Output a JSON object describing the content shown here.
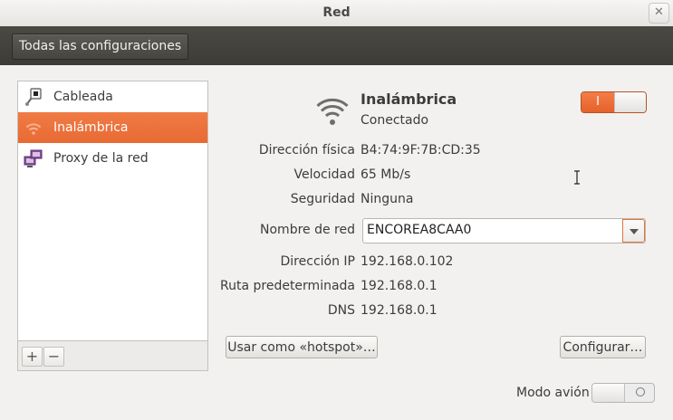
{
  "window": {
    "title": "Red"
  },
  "toolbar": {
    "all_settings_label": "Todas las configuraciones"
  },
  "sidebar": {
    "items": [
      {
        "label": "Cableada",
        "icon": "wired-network-icon",
        "selected": false
      },
      {
        "label": "Inalámbrica",
        "icon": "wifi-icon",
        "selected": true
      },
      {
        "label": "Proxy de la red",
        "icon": "proxy-network-icon",
        "selected": false
      }
    ],
    "add_label": "+",
    "remove_label": "−"
  },
  "device": {
    "name": "Inalámbrica",
    "status": "Conectado",
    "enabled_toggle_label": "I",
    "enabled": true
  },
  "details": [
    {
      "label": "Dirección física",
      "value": "B4:74:9F:7B:CD:35"
    },
    {
      "label": "Velocidad",
      "value": "65 Mb/s"
    },
    {
      "label": "Seguridad",
      "value": "Ninguna"
    }
  ],
  "network_name": {
    "label": "Nombre de red",
    "value": "ENCOREA8CAA0"
  },
  "ip_details": [
    {
      "label": "Dirección IP",
      "value": "192.168.0.102"
    },
    {
      "label": "Ruta predeterminada",
      "value": "192.168.0.1"
    },
    {
      "label": "DNS",
      "value": "192.168.0.1"
    }
  ],
  "buttons": {
    "hotspot_label": "Usar como «hotspot»…",
    "configure_label": "Configurar…"
  },
  "airplane": {
    "label": "Modo avión",
    "enabled": false
  },
  "colors": {
    "accent": "#e9703a",
    "toolbar": "#45443f"
  }
}
